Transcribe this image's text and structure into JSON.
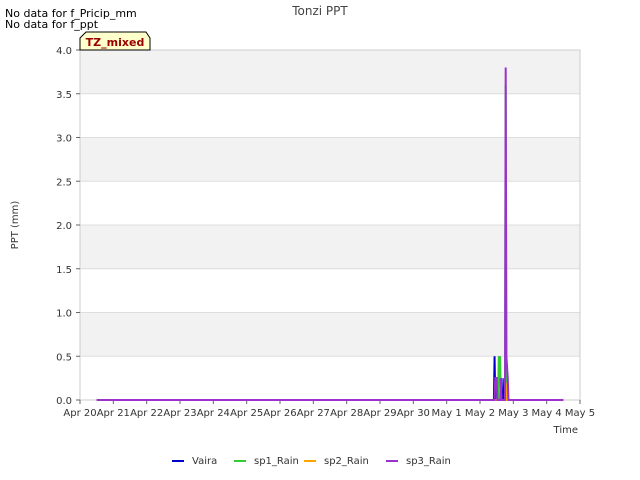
{
  "notes": [
    "No data for f_Pricip_mm",
    "No data for f_ppt"
  ],
  "site_badge": "TZ_mixed",
  "chart_data": {
    "type": "line",
    "title": "Tonzi PPT",
    "xlabel": "Time",
    "ylabel": "PPT (mm)",
    "ylim": [
      0,
      4.0
    ],
    "yticks": [
      0.0,
      0.5,
      1.0,
      1.5,
      2.0,
      2.5,
      3.0,
      3.5,
      4.0
    ],
    "ytick_labels": [
      "0.0",
      "0.5",
      "1.0",
      "1.5",
      "2.0",
      "2.5",
      "3.0",
      "3.5",
      "4.0"
    ],
    "xlim": [
      "2024-04-20",
      "2024-05-05"
    ],
    "xtick_labels": [
      "Apr 20",
      "Apr 21",
      "Apr 22",
      "Apr 23",
      "Apr 24",
      "Apr 25",
      "Apr 26",
      "Apr 27",
      "Apr 28",
      "Apr 29",
      "Apr 30",
      "May 1",
      "May 2",
      "May 3",
      "May 4",
      "May 5"
    ],
    "grid": "horizontal bands",
    "legend_placement": "bottom",
    "series": [
      {
        "name": "Vaira",
        "color": "#0000cc",
        "x": [
          "2024-04-20T12:00",
          "2024-05-02T10:00",
          "2024-05-02T10:30",
          "2024-05-02T11:00",
          "2024-05-02T11:30",
          "2024-05-02T13:30",
          "2024-05-02T14:00",
          "2024-05-02T15:00",
          "2024-05-02T15:30",
          "2024-05-02T16:00",
          "2024-05-02T17:00",
          "2024-05-02T17:30",
          "2024-05-02T18:00",
          "2024-05-02T18:30",
          "2024-05-02T19:00",
          "2024-05-04T12:00"
        ],
        "y": [
          0,
          0,
          0.5,
          0,
          0.25,
          0.25,
          0.5,
          0,
          0.25,
          0,
          0,
          0.25,
          0,
          0,
          0,
          0
        ]
      },
      {
        "name": "sp1_Rain",
        "color": "#33cc33",
        "x": [
          "2024-04-20T12:00",
          "2024-05-02T13:00",
          "2024-05-02T13:30",
          "2024-05-02T14:00",
          "2024-05-02T14:30",
          "2024-05-02T15:00",
          "2024-05-02T18:00",
          "2024-05-02T18:30",
          "2024-05-02T19:00",
          "2024-05-04T12:00"
        ],
        "y": [
          0,
          0,
          0.5,
          0.25,
          0.5,
          0,
          0,
          3.6,
          0,
          0
        ]
      },
      {
        "name": "sp2_Rain",
        "color": "#ffa500",
        "x": [
          "2024-04-20T12:00",
          "2024-05-02T18:00",
          "2024-05-02T18:30",
          "2024-05-02T19:00",
          "2024-05-04T12:00"
        ],
        "y": [
          0,
          0,
          0.2,
          0,
          0
        ]
      },
      {
        "name": "sp3_Rain",
        "color": "#9933cc",
        "x": [
          "2024-04-20T12:00",
          "2024-05-02T10:30",
          "2024-05-02T11:00",
          "2024-05-02T11:30",
          "2024-05-02T12:00",
          "2024-05-02T12:30",
          "2024-05-02T14:30",
          "2024-05-02T15:00",
          "2024-05-02T15:30",
          "2024-05-02T18:00",
          "2024-05-02T18:30",
          "2024-05-02T19:00",
          "2024-05-02T20:00",
          "2024-05-02T20:30",
          "2024-05-04T12:00"
        ],
        "y": [
          0,
          0,
          0.25,
          0.25,
          0.25,
          0,
          0,
          0.25,
          0,
          0,
          3.8,
          0.5,
          0.25,
          0,
          0
        ]
      }
    ]
  }
}
